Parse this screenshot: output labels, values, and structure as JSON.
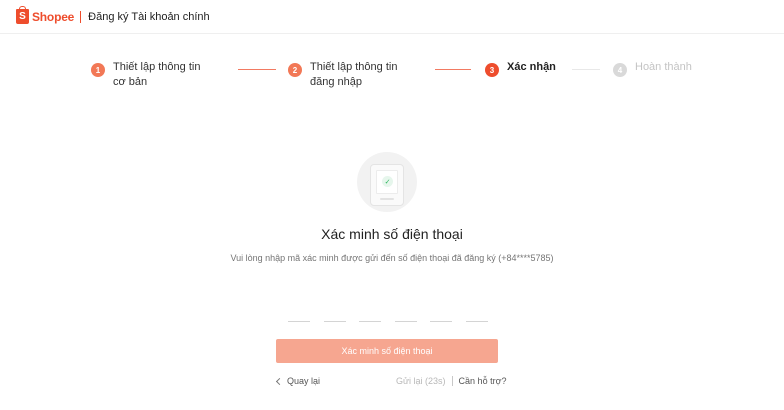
{
  "header": {
    "logo_glyph": "S",
    "brand": "Shopee",
    "title": "Đăng ký Tài khoản chính",
    "brand_color": "#ee4d2d"
  },
  "stepper": {
    "steps": [
      {
        "number": "1",
        "label": "Thiết lập thông tin cơ bản",
        "status": "done"
      },
      {
        "number": "2",
        "label": "Thiết lập thông tin đăng nhập",
        "status": "done"
      },
      {
        "number": "3",
        "label": "Xác nhận",
        "status": "active"
      },
      {
        "number": "4",
        "label": "Hoàn thành",
        "status": "todo"
      }
    ]
  },
  "illustration": {
    "icon": "phone-check-icon"
  },
  "verify": {
    "title": "Xác minh số điện thoại",
    "description": "Vui lòng nhập mã xác minh được gửi đến số điện thoại đã đăng ký (+84****5785)"
  },
  "otp": {
    "cells": [
      "",
      "",
      "",
      "",
      "",
      ""
    ]
  },
  "actions": {
    "submit_label": "Xác minh số điện thoại",
    "back_label": "Quay lại",
    "resend_label": "Gửi lại (23s)",
    "help_label": "Cần hỗ trợ?"
  }
}
